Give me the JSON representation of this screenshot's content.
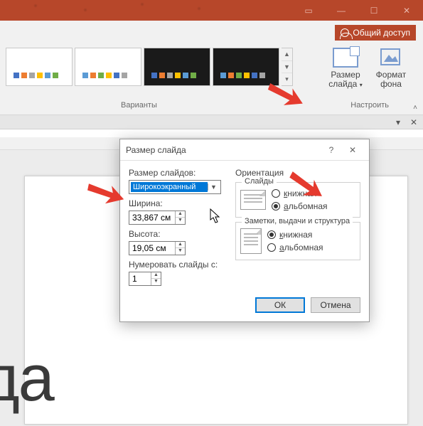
{
  "titlebar": {
    "share_label": "Общий доступ"
  },
  "ribbon": {
    "variants_label": "Варианты",
    "setup_label": "Настроить",
    "size_btn_l1": "Размер",
    "size_btn_l2": "слайда",
    "format_btn_l1": "Формат",
    "format_btn_l2": "фона"
  },
  "dialog": {
    "title": "Размер слайда",
    "size_for_label": "Размер слайдов:",
    "size_for_value": "Широкоэкранный",
    "width_label": "Ширина:",
    "width_value": "33,867 см",
    "height_label": "Высота:",
    "height_value": "19,05 см",
    "number_from_label": "Нумеровать слайды с:",
    "number_from_value": "1",
    "orientation_label": "Ориентация",
    "slides_label": "Слайды",
    "notes_label": "Заметки, выдачи и структура",
    "portrait_pre": "к",
    "portrait_rest": "нижная",
    "landscape_pre": "а",
    "landscape_rest": "льбомная",
    "ok": "ОК",
    "cancel": "Отмена"
  },
  "slide_text": "да"
}
